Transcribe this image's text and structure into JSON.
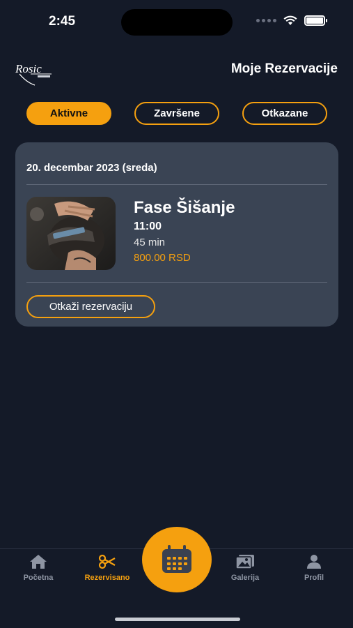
{
  "status_bar": {
    "time": "2:45"
  },
  "header": {
    "logo_text": "Rosic",
    "title": "Moje Rezervacije"
  },
  "tabs": [
    {
      "label": "Aktivne",
      "active": true
    },
    {
      "label": "Završene",
      "active": false
    },
    {
      "label": "Otkazane",
      "active": false
    }
  ],
  "reservation": {
    "date": "20. decembar 2023 (sreda)",
    "service": "Fase Šišanje",
    "time": "11:00",
    "duration": "45 min",
    "price": "800.00 RSD",
    "cancel_label": "Otkaži rezervaciju",
    "image_icon": "haircut-photo"
  },
  "bottom_nav": {
    "items": [
      {
        "label": "Početna",
        "icon": "home-icon",
        "active": false
      },
      {
        "label": "Rezervisano",
        "icon": "scissors-icon",
        "active": true
      },
      {
        "label": "Galerija",
        "icon": "gallery-icon",
        "active": false
      },
      {
        "label": "Profil",
        "icon": "person-icon",
        "active": false
      }
    ],
    "fab_icon": "calendar-icon"
  },
  "colors": {
    "accent": "#f5a00f",
    "background": "#141a28",
    "card": "#3a4454"
  }
}
